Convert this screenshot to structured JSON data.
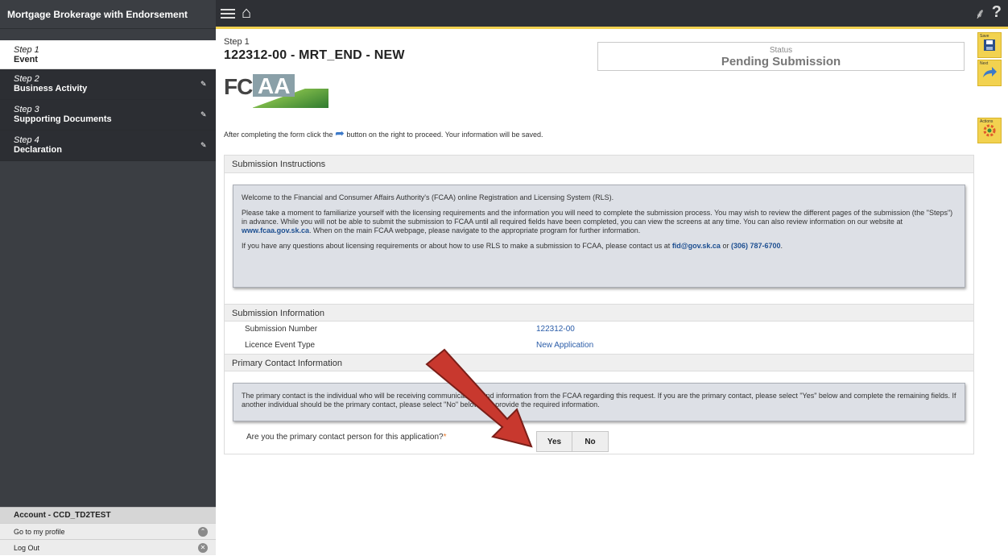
{
  "sidebar": {
    "title": "Mortgage Brokerage with Endorsement",
    "steps": [
      {
        "num": "Step 1",
        "name": "Event",
        "active": true
      },
      {
        "num": "Step 2",
        "name": "Business Activity"
      },
      {
        "num": "Step 3",
        "name": "Supporting Documents"
      },
      {
        "num": "Step 4",
        "name": "Declaration"
      }
    ],
    "account": "Account - CCD_TD2TEST",
    "profile_link": "Go to my profile",
    "logout_link": "Log Out"
  },
  "header": {
    "step_label": "Step 1",
    "title": "122312-00 - MRT_END - NEW",
    "status_label": "Status",
    "status_value": "Pending Submission"
  },
  "logo": {
    "left": "FC",
    "right": "AA"
  },
  "actions": {
    "save": "Save",
    "next": "Next",
    "actions": "Actions"
  },
  "instruction": {
    "before": "After completing the form click the",
    "after": "button on the right to proceed. Your information will be saved."
  },
  "sections": {
    "submission_instructions": {
      "heading": "Submission Instructions",
      "p1": "Welcome to the Financial and Consumer Affairs Authority's (FCAA) online Registration and Licensing System (RLS).",
      "p2a": "Please take a moment to familiarize yourself with the licensing requirements and the information you will need to complete the submission process. You may wish to review the different pages of the submission (the \"Steps\") in advance. While you will not be able to submit the submission to FCAA until all required fields have been completed, you can view the screens at any time. You can also review information on our website at",
      "p2_link": "www.fcaa.gov.sk.ca",
      "p2b": ". When on the main FCAA webpage, please navigate to the appropriate program for further information.",
      "p3a": "If you have any questions about licensing requirements or about how to use RLS to make a submission to FCAA, please contact us at",
      "p3_email": "fid@gov.sk.ca",
      "p3_or": "or",
      "p3_phone": "(306) 787-6700",
      "p3_end": "."
    },
    "submission_information": {
      "heading": "Submission Information",
      "rows": [
        {
          "label": "Submission Number",
          "value": "122312-00"
        },
        {
          "label": "Licence Event Type",
          "value": "New Application"
        }
      ]
    },
    "primary_contact": {
      "heading": "Primary Contact Information",
      "info": "The primary contact is the individual who will be receiving communications and information from the FCAA regarding this request. If you are the primary contact, please select \"Yes\" below and complete the remaining fields. If another individual should be the primary contact, please select \"No\" below and provide the required information.",
      "question": "Are you the primary contact person for this application?",
      "required_mark": "*",
      "yes": "Yes",
      "no": "No"
    }
  },
  "colors": {
    "accent_yellow": "#f2d250",
    "sidebar_dark": "#2c2e33",
    "link_blue": "#1d4f91",
    "arrow_red": "#c0392b"
  }
}
